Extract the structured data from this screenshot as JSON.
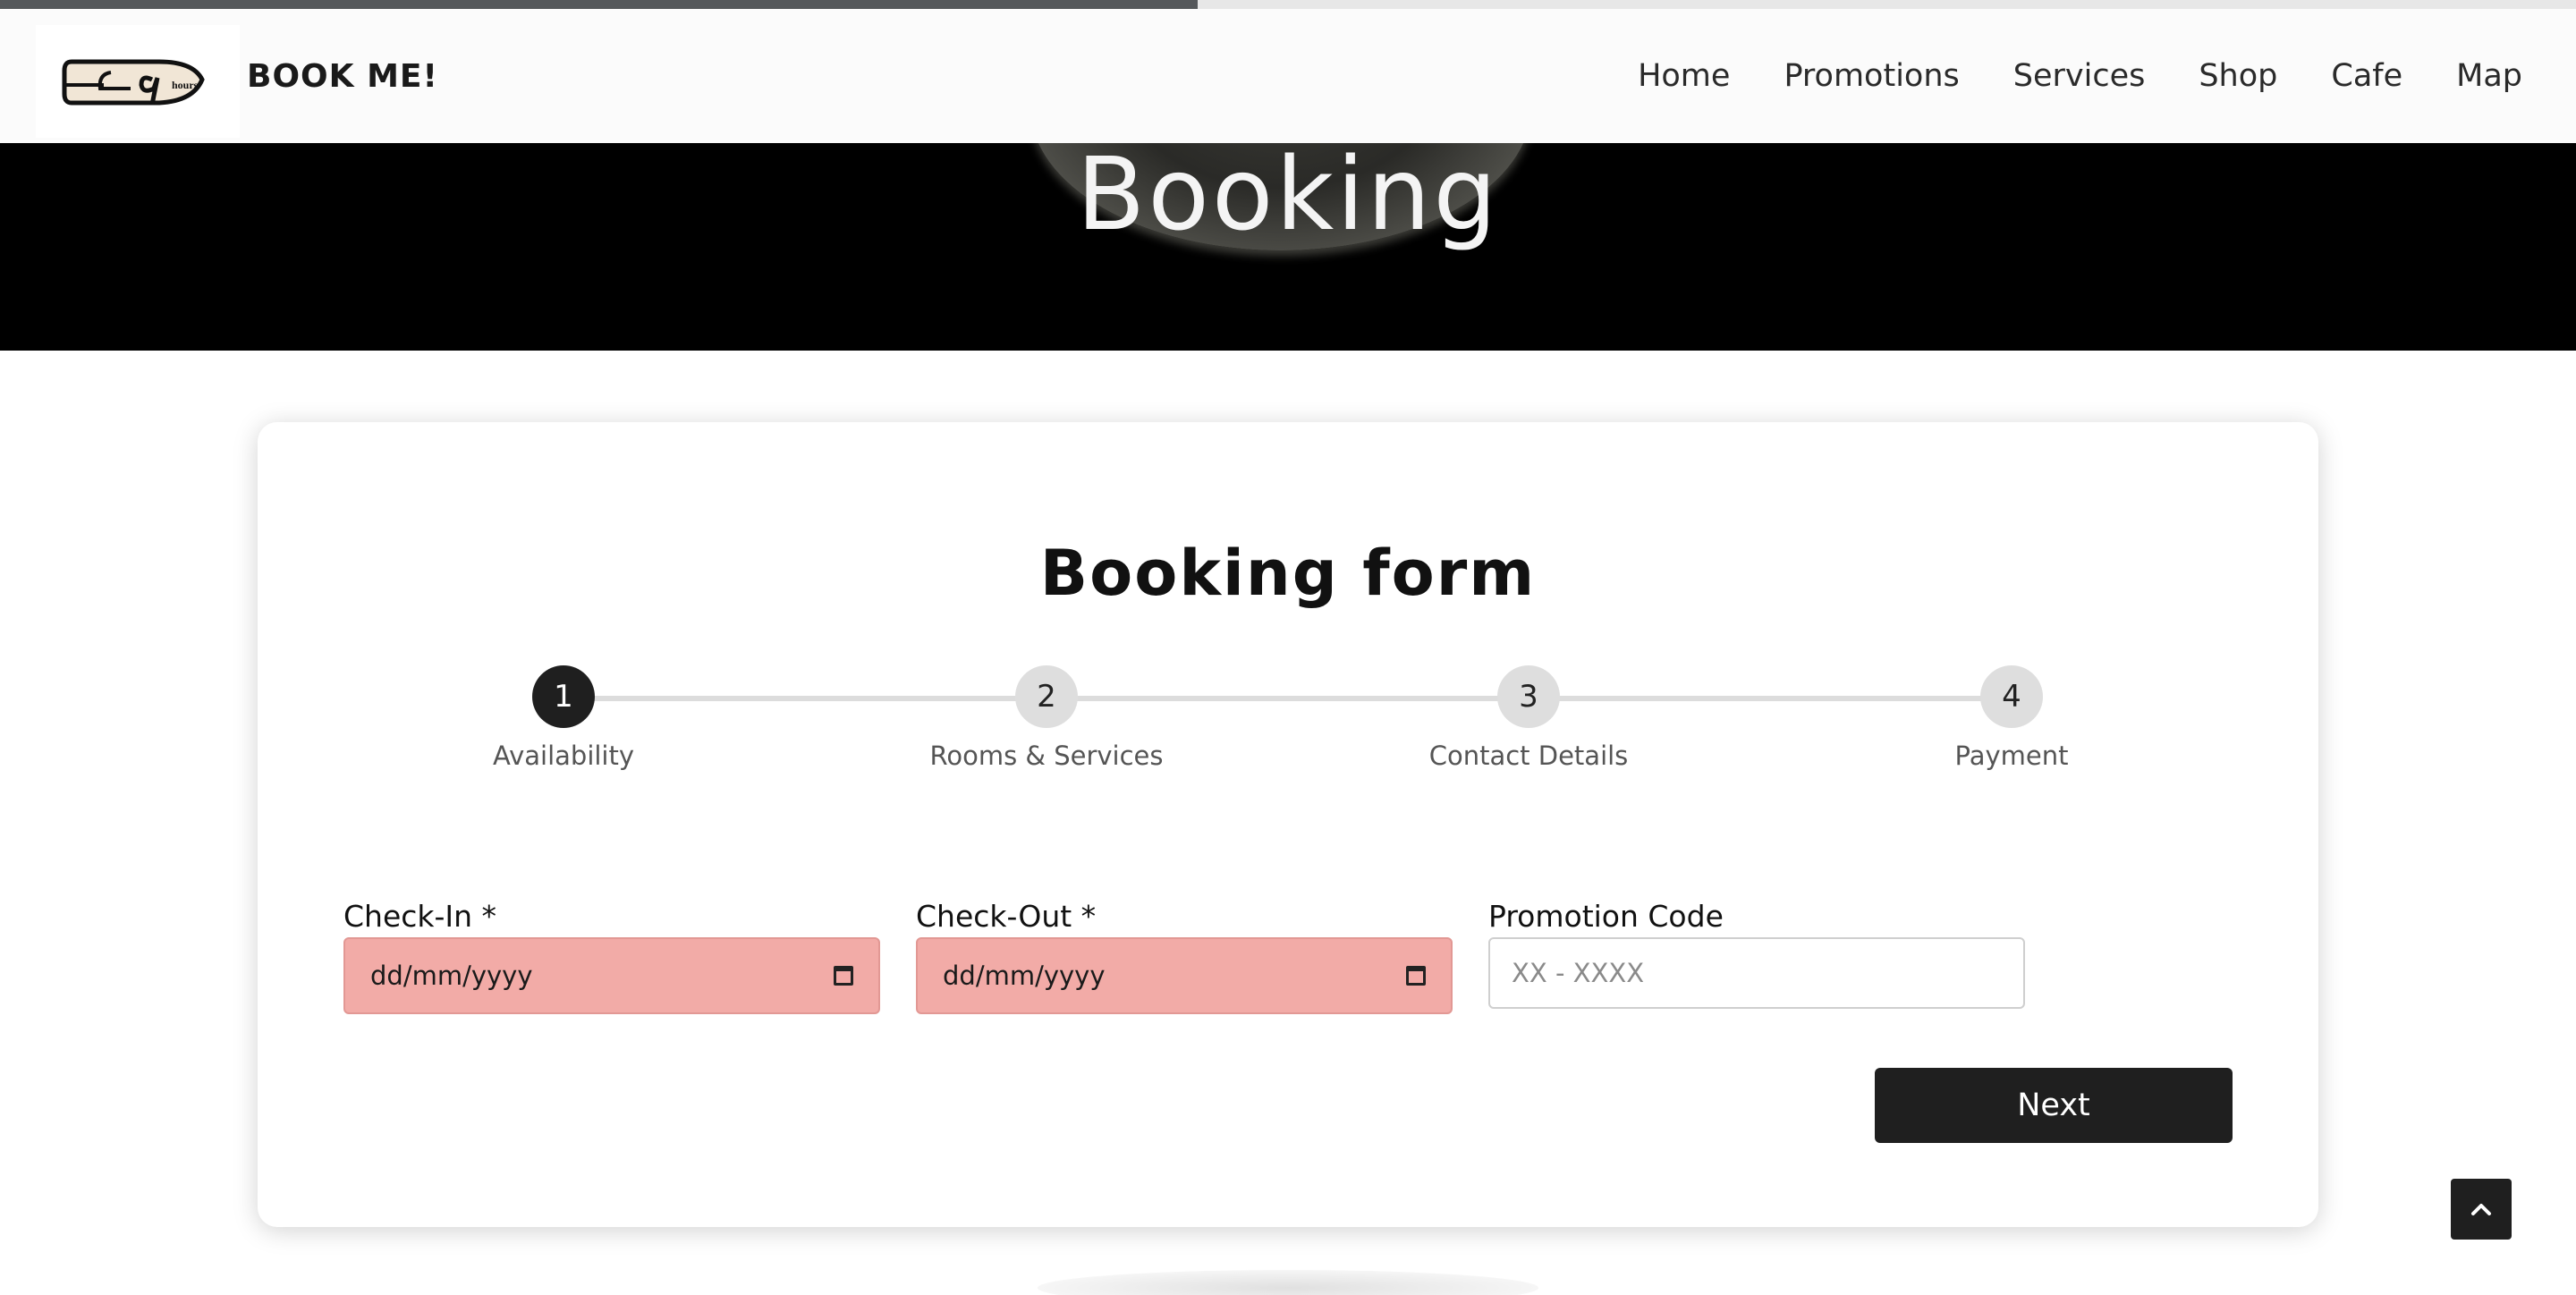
{
  "scroll_progress_fraction": 0.465,
  "brand": {
    "name": "BOOK ME!",
    "logo_icon": "capsule-hours-logo-icon"
  },
  "nav": [
    "Home",
    "Promotions",
    "Services",
    "Shop",
    "Cafe",
    "Map"
  ],
  "hero": {
    "title": "Booking"
  },
  "form": {
    "title": "Booking form",
    "steps": [
      {
        "number": "1",
        "label": "Availability",
        "active": true
      },
      {
        "number": "2",
        "label": "Rooms & Services",
        "active": false
      },
      {
        "number": "3",
        "label": "Contact Details",
        "active": false
      },
      {
        "number": "4",
        "label": "Payment",
        "active": false
      }
    ],
    "check_in": {
      "label": "Check-In *",
      "value": "dd/mm/yyyy",
      "icon": "calendar-icon"
    },
    "check_out": {
      "label": "Check-Out *",
      "value": "dd/mm/yyyy",
      "icon": "calendar-icon"
    },
    "promo": {
      "label": "Promotion Code",
      "placeholder": "XX - XXXX"
    },
    "next_label": "Next"
  },
  "colors": {
    "invalid_field": "#f2aba7",
    "dark_accent": "#1f1f1f",
    "step_inactive": "#dedede"
  },
  "back_to_top_icon": "chevron-up-icon"
}
